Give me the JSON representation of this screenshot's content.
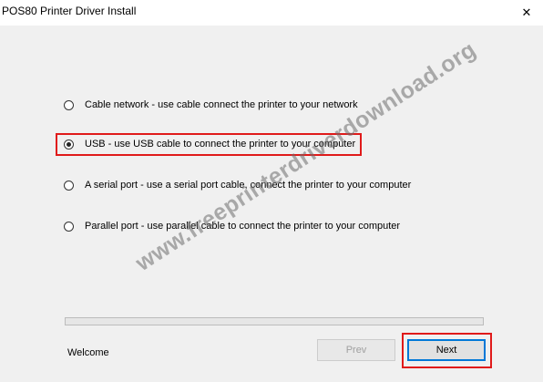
{
  "window": {
    "title": "POS80 Printer Driver Install",
    "close_glyph": "✕"
  },
  "options": [
    {
      "label": "Cable network - use cable connect the printer to your network",
      "selected": false
    },
    {
      "label": "USB - use USB cable to connect the printer to your computer",
      "selected": true
    },
    {
      "label": "A serial port - use a serial port cable, connect the printer to your computer",
      "selected": false
    },
    {
      "label": "Parallel port - use parallel cable to connect the printer to your computer",
      "selected": false
    }
  ],
  "progress": 0,
  "status": "Welcome",
  "buttons": {
    "prev": {
      "label": "Prev",
      "enabled": false
    },
    "next": {
      "label": "Next",
      "enabled": true
    }
  },
  "watermark": "www.freeprinterdriverdownload.org",
  "colors": {
    "highlight": "#e01a1a",
    "dialog_bg": "#f0f0f0",
    "focus": "#0078d7"
  },
  "icons": {
    "close": "close-icon"
  }
}
